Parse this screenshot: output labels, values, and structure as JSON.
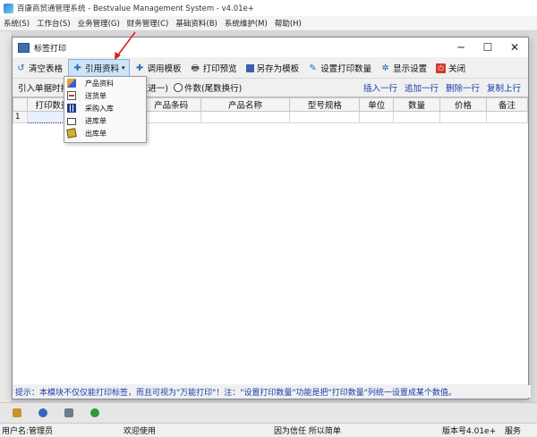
{
  "app": {
    "title": "百康商贸通管理系统 - Bestvalue Management System - v4.01e+"
  },
  "menubar": {
    "items": [
      "系统(S)",
      "工作台(S)",
      "业务管理(G)",
      "财务管理(C)",
      "基础资料(B)",
      "系统维护(M)",
      "帮助(H)"
    ]
  },
  "dialog": {
    "title": "标签打印",
    "minimize": "─",
    "maximize": "☐",
    "close": "✕"
  },
  "toolbar": {
    "clear": "清空表格",
    "reference": "引用资料",
    "template": "调用模板",
    "preview": "打印预览",
    "save_template": "另存为模板",
    "set_qty": "设置打印数量",
    "display": "显示设置",
    "close": "关闭"
  },
  "options": {
    "label": "引入单据时打印数量",
    "radio1": "件数(尾数进一)",
    "radio2": "件数(尾数换行)",
    "links": [
      "插入一行",
      "追加一行",
      "删除一行",
      "复制上行"
    ]
  },
  "grid": {
    "headers": [
      "打印数量",
      "",
      "产品条码",
      "产品名称",
      "型号规格",
      "单位",
      "数量",
      "价格",
      "备注"
    ],
    "rows": [
      [
        "1",
        "",
        "",
        "",
        "",
        "",
        "",
        "",
        "",
        ""
      ]
    ]
  },
  "dropdown": {
    "items": [
      "产品资料",
      "送货单",
      "采购入库",
      "进库单",
      "出库单"
    ]
  },
  "hint": "提示：本模块不仅仅能打印标签，而且可视为\"万能打印\"！注：\"设置打印数量\"功能是把\"打印数量\"列统一设置成某个数值。",
  "status": {
    "user": "用户名:管理员",
    "welcome": "欢迎使用",
    "slogan": "因为信任 所以简单",
    "version": "版本号4.01e+",
    "service": "服务"
  },
  "colors": {
    "accent_blue": "#1a3caa",
    "arrow_red": "#d8201e",
    "active_button": "#cce4f7"
  }
}
